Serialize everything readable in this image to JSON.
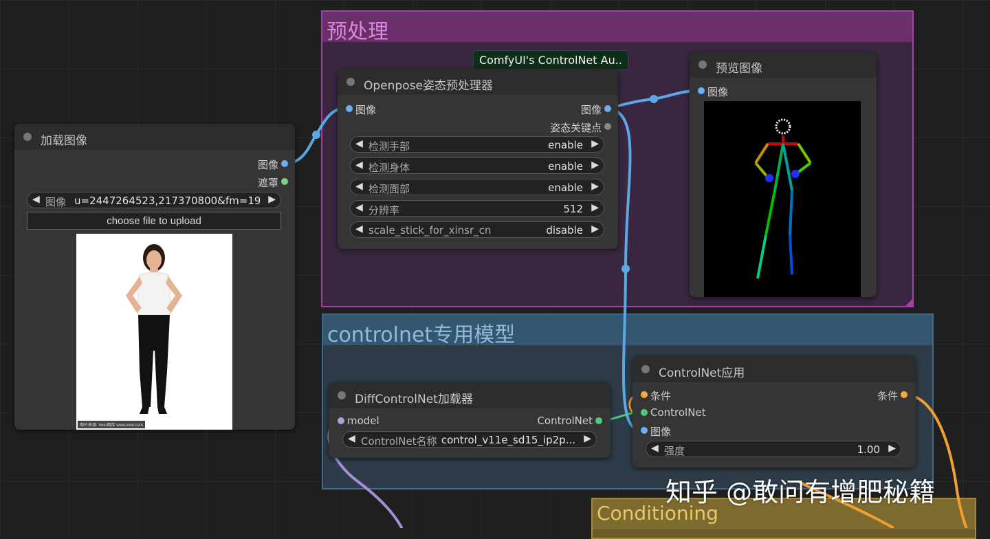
{
  "groups": {
    "preprocess": {
      "title": "预处理"
    },
    "controlnet_models": {
      "title": "controlnet专用模型"
    },
    "conditioning": {
      "title": "Conditioning"
    }
  },
  "badge": {
    "text": "ComfyUI's ControlNet Au.."
  },
  "nodes": {
    "load_image": {
      "title": "加载图像",
      "outputs": {
        "image": "图像",
        "mask": "遮罩"
      },
      "image_widget": {
        "label": "图像",
        "value": "u=2447264523,217370800&fm=19..."
      },
      "upload_button": "choose file to upload",
      "caption": "图片来源: Veer图库 www.veer.com"
    },
    "openpose": {
      "title": "Openpose姿态预处理器",
      "input": "图像",
      "outputs": {
        "image": "图像",
        "keypoints": "姿态关键点"
      },
      "widgets": [
        {
          "label": "检测手部",
          "value": "enable"
        },
        {
          "label": "检测身体",
          "value": "enable"
        },
        {
          "label": "检测面部",
          "value": "enable"
        },
        {
          "label": "分辨率",
          "value": "512"
        },
        {
          "label": "scale_stick_for_xinsr_cn",
          "value": "disable"
        }
      ]
    },
    "preview": {
      "title": "预览图像",
      "input": "图像"
    },
    "diff_loader": {
      "title": "DiffControlNet加载器",
      "input": "model",
      "output": "ControlNet",
      "widget": {
        "label": "ControlNet名称",
        "value": "control_v11e_sd15_ip2p..."
      }
    },
    "apply": {
      "title": "ControlNet应用",
      "inputs": {
        "cond": "条件",
        "controlnet": "ControlNet",
        "image": "图像"
      },
      "output": "条件",
      "widget": {
        "label": "强度",
        "value": "1.00"
      }
    }
  },
  "watermark": "知乎 @敢问有增肥秘籍",
  "colors": {
    "image_slot": "#6ab0f3",
    "mask_slot": "#7fd37f",
    "keypoint_slot": "#888888",
    "model_slot": "#b39ddb",
    "conditioning_slot": "#f5a742",
    "controlnet_slot": "#50c878",
    "link_image": "#5aa9e6",
    "link_conditioning": "#f0a030",
    "link_model": "#a58fd8"
  }
}
